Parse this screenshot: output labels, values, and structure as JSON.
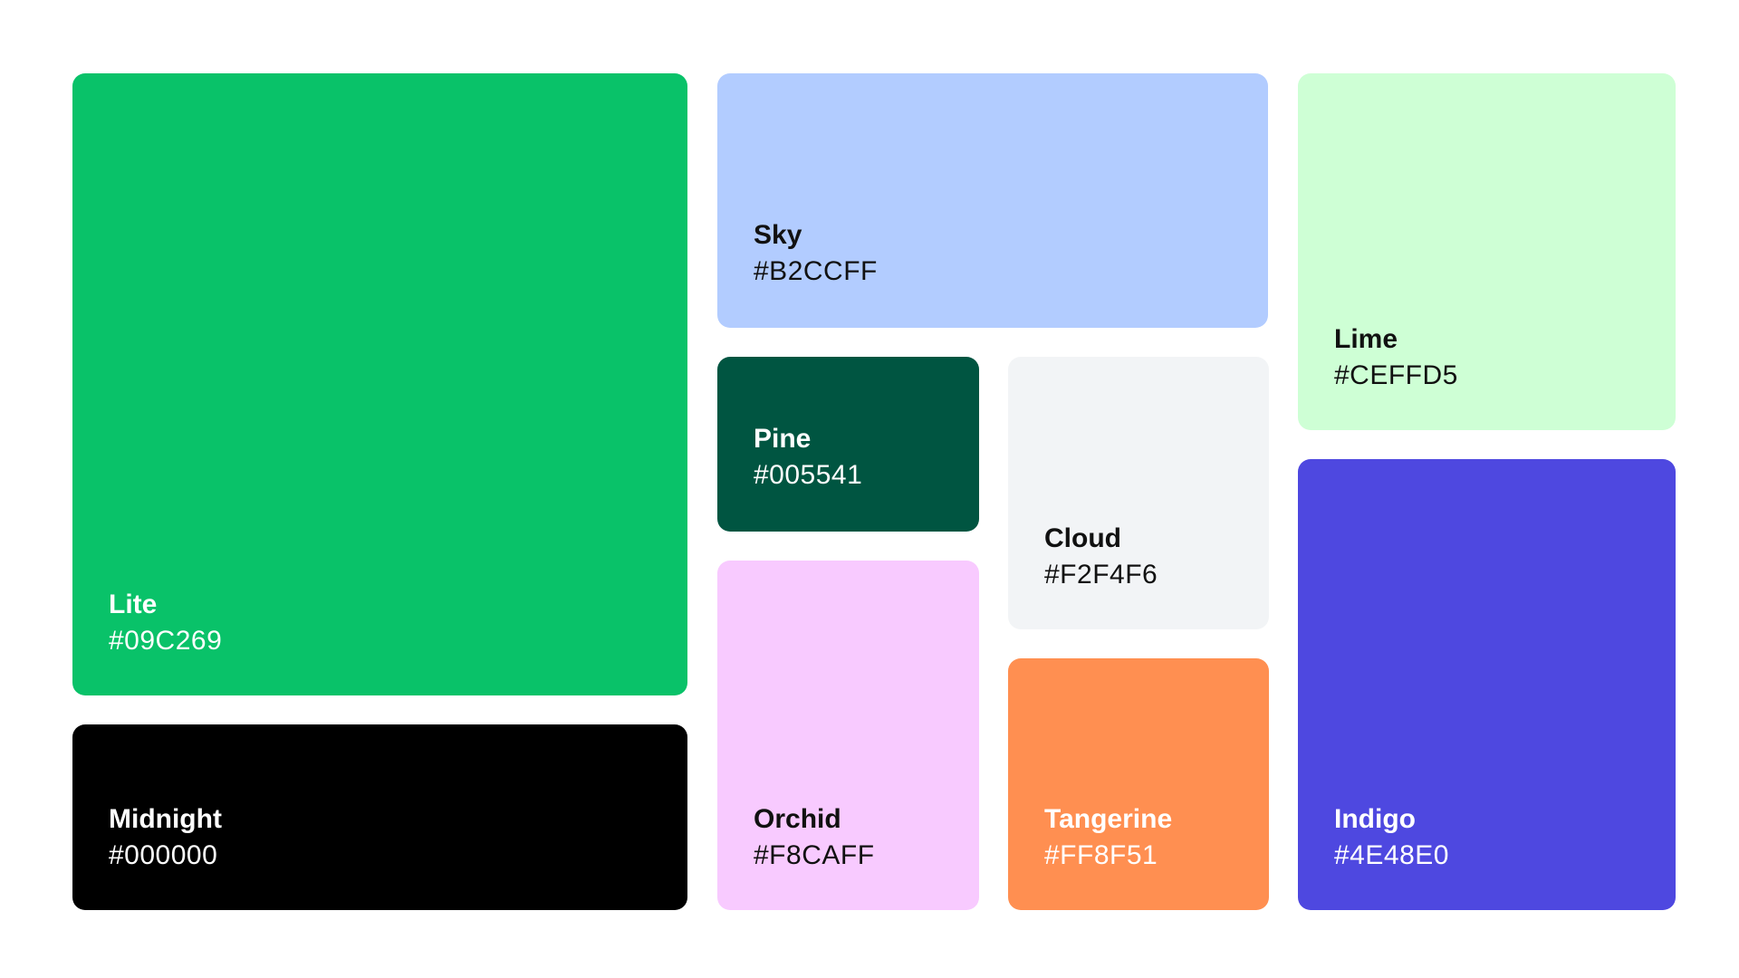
{
  "swatches": {
    "lite": {
      "name": "Lite",
      "hex": "#09C269",
      "color": "#09C269"
    },
    "midnight": {
      "name": "Midnight",
      "hex": "#000000",
      "color": "#000000"
    },
    "sky": {
      "name": "Sky",
      "hex": "#B2CCFF",
      "color": "#B2CCFF"
    },
    "pine": {
      "name": "Pine",
      "hex": "#005541",
      "color": "#005541"
    },
    "orchid": {
      "name": "Orchid",
      "hex": "#F8CAFF",
      "color": "#F8CAFF"
    },
    "cloud": {
      "name": "Cloud",
      "hex": "#F2F4F6",
      "color": "#F2F4F6"
    },
    "tangerine": {
      "name": "Tangerine",
      "hex": "#FF8F51",
      "color": "#FF8F51"
    },
    "lime": {
      "name": "Lime",
      "hex": "#CEFFD5",
      "color": "#CEFFD5"
    },
    "indigo": {
      "name": "Indigo",
      "hex": "#4E48E0",
      "color": "#4E48E0"
    }
  }
}
